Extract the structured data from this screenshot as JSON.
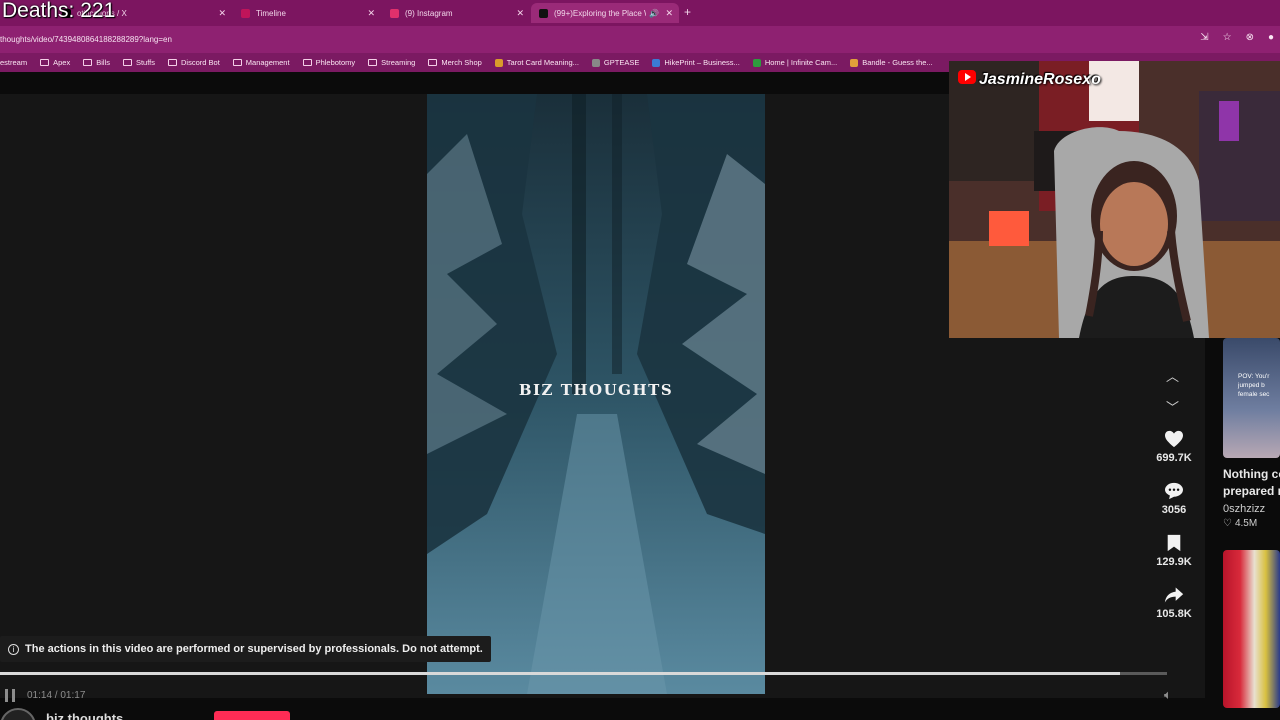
{
  "overlay": {
    "deaths_text": "Deaths: 221"
  },
  "browser": {
    "tabs": [
      {
        "label": "otifications / X",
        "color": "#ffffff"
      },
      {
        "label": "Timeline",
        "color": "#c0145a"
      },
      {
        "label": "(9) Instagram",
        "color": "#e1306c"
      },
      {
        "label": "(99+)Exploring the Place W",
        "color": "#111111"
      }
    ],
    "url": "thoughts/video/7439480864188288289?lang=en",
    "bookmarks": [
      {
        "label": "estream",
        "type": "folder"
      },
      {
        "label": "Apex",
        "type": "folder"
      },
      {
        "label": "Bills",
        "type": "folder"
      },
      {
        "label": "Stuffs",
        "type": "folder"
      },
      {
        "label": "Discord Bot",
        "type": "folder"
      },
      {
        "label": "Management",
        "type": "folder"
      },
      {
        "label": "Phlebotomy",
        "type": "folder"
      },
      {
        "label": "Streaming",
        "type": "folder"
      },
      {
        "label": "Merch Shop",
        "type": "folder"
      },
      {
        "label": "Tarot Card Meaning...",
        "type": "site",
        "color": "#d99c2b"
      },
      {
        "label": "GPTEASE",
        "type": "site",
        "color": "#888888"
      },
      {
        "label": "HikePrint – Business...",
        "type": "site",
        "color": "#3a7bd5"
      },
      {
        "label": "Home | Infinite Cam...",
        "type": "site",
        "color": "#2e9b3e"
      },
      {
        "label": "Bandle - Guess the...",
        "type": "site",
        "color": "#e0a03a"
      }
    ]
  },
  "video": {
    "title_text": "BIZ THOUGHTS",
    "warning_text": "The actions in this video are performed or supervised by professionals. Do not attempt.",
    "progress_fraction": 0.96,
    "current_time": "01:14",
    "duration": "01:17",
    "time_label": "01:14 / 01:17",
    "author": "biz.thoughts"
  },
  "actions": {
    "likes": "699.7K",
    "comments": "3056",
    "bookmarks": "129.9K",
    "shares": "105.8K"
  },
  "recommendations": [
    {
      "thumb_text": "POV: You'r jumped b female sec",
      "title_line1": "Nothing co",
      "title_line2": "prepared n",
      "author": "0szhzizz",
      "views": "4.5M"
    },
    {
      "title_line1": "",
      "author": "",
      "views": ""
    }
  ],
  "webcam": {
    "channel_name": "JasmineRosexo"
  },
  "colors": {
    "accent": "#fe2c55",
    "tabbar": "#7c1560",
    "addressbar": "#8e2171"
  }
}
